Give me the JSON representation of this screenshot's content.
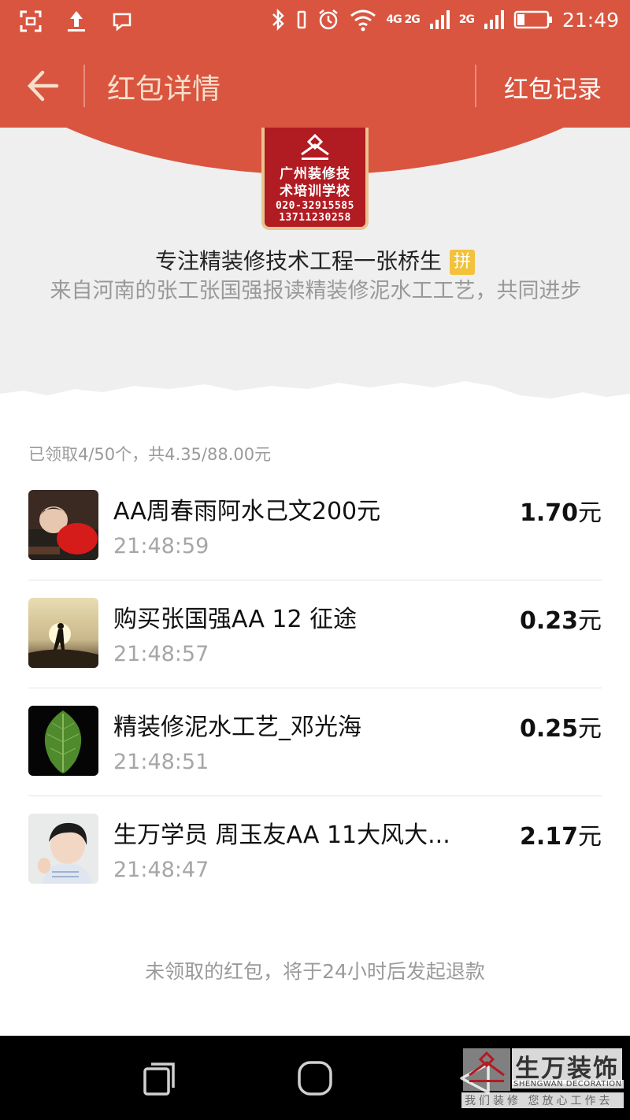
{
  "status_bar": {
    "network_1": "4G 2G",
    "network_2": "2G",
    "time": "21:49"
  },
  "title_bar": {
    "title": "红包详情",
    "records_label": "红包记录"
  },
  "header": {
    "logo": {
      "line1": "广州装修技",
      "line2": "术培训学校",
      "line3": "020-32915585",
      "line4": "13711230258"
    },
    "sender_name": "专注精装修技术工程一张桥生",
    "pin_badge": "拼",
    "greeting": "来自河南的张工张国强报读精装修泥水工工艺，共同进步"
  },
  "summary": "已领取4/50个，共4.35/88.00元",
  "items": [
    {
      "name": "AA周春雨阿水己文200元",
      "time": "21:48:59",
      "amount": "1.70",
      "unit": "元"
    },
    {
      "name": "购买张国强AA  12  征途",
      "time": "21:48:57",
      "amount": "0.23",
      "unit": "元"
    },
    {
      "name": "精装修泥水工艺_邓光海",
      "time": "21:48:51",
      "amount": "0.25",
      "unit": "元"
    },
    {
      "name": "生万学员 周玉友AA  11大风大...",
      "time": "21:48:47",
      "amount": "2.17",
      "unit": "元"
    }
  ],
  "footer_note": "未领取的红包，将于24小时后发起退款",
  "watermark": {
    "main": "生万装饰",
    "en": "SHENGWAN DECORATION",
    "sub": "我们装修 您放心工作去"
  },
  "colors": {
    "accent": "#d9553f",
    "title_text": "#f6dfcb",
    "background": "#efefef"
  },
  "icons": [
    "screenshot-icon",
    "upload-icon",
    "message-icon",
    "bluetooth-icon",
    "vibrate-icon",
    "alarm-icon",
    "wifi-icon",
    "signal-icon",
    "battery-icon",
    "back-arrow-icon",
    "recent-apps-icon",
    "home-icon",
    "back-triangle-icon"
  ]
}
